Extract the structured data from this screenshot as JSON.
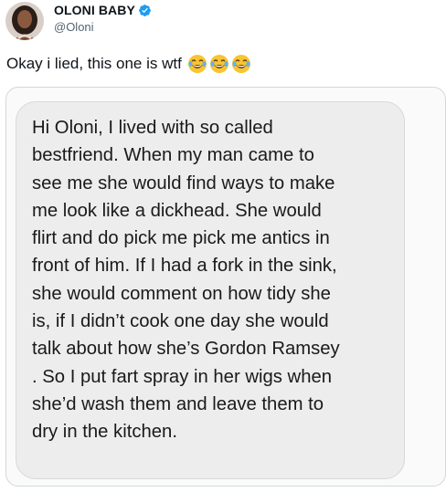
{
  "tweet": {
    "author": {
      "display_name": "OLONI BABY",
      "handle": "@Oloni",
      "verified": true,
      "avatar_icon": "profile-avatar"
    },
    "text": "Okay i lied, this one is wtf",
    "emojis": [
      "face-with-tears-of-joy",
      "face-with-tears-of-joy",
      "face-with-tears-of-joy"
    ],
    "media": {
      "message_lines": [
        "Hi Oloni, I lived with so called",
        "bestfriend. When my man came to",
        "see me she would find ways to make",
        "me look like a dickhead. She would",
        "flirt and do pick me pick me antics in",
        "front of him. If I had a fork in the sink,",
        "she would comment on how tidy she",
        "is, if I didn’t cook one day she would",
        "talk about how she’s Gordon Ramsey",
        ". So I put fart spray in her wigs when",
        "she’d wash them and leave them to",
        "dry in the kitchen."
      ]
    }
  },
  "colors": {
    "verified_blue": "#1d9bf0",
    "handle_gray": "#536471",
    "bubble_gray": "#ededed"
  }
}
